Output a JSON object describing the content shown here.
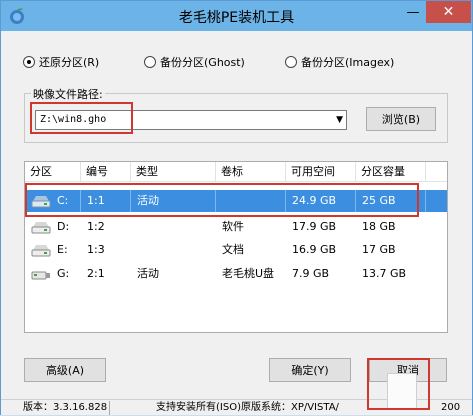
{
  "window": {
    "title": "老毛桃PE装机工具",
    "minimize_glyph": "—",
    "close_glyph": "✕"
  },
  "modes": [
    {
      "label": "还原分区(R)",
      "checked": true
    },
    {
      "label": "备份分区(Ghost)",
      "checked": false
    },
    {
      "label": "备份分区(Imagex)",
      "checked": false
    }
  ],
  "image_path": {
    "label": "映像文件路径:",
    "value": "Z:\\win8.gho",
    "browse_label": "浏览(B)"
  },
  "partition_table": {
    "columns": [
      "分区",
      "编号",
      "类型",
      "卷标",
      "可用空间",
      "分区容量"
    ],
    "rows": [
      {
        "drive": "C:",
        "number": "1:1",
        "type": "活动",
        "label": "",
        "free": "24.9 GB",
        "capacity": "25 GB",
        "selected": true
      },
      {
        "drive": "D:",
        "number": "1:2",
        "type": "",
        "label": "软件",
        "free": "17.9 GB",
        "capacity": "18 GB",
        "selected": false
      },
      {
        "drive": "E:",
        "number": "1:3",
        "type": "",
        "label": "文档",
        "free": "16.9 GB",
        "capacity": "17 GB",
        "selected": false
      },
      {
        "drive": "G:",
        "number": "2:1",
        "type": "活动",
        "label": "老毛桃U盘",
        "free": "7.9 GB",
        "capacity": "13.7 GB",
        "selected": false
      }
    ]
  },
  "buttons": {
    "advanced": "高级(A)",
    "ok": "确定(Y)",
    "cancel": "取消"
  },
  "statusbar": {
    "version": "版本：3.3.16.828",
    "systems": "支持安装所有(ISO)原版系统：XP/VISTA/",
    "right": "200"
  },
  "colors": {
    "title_bar": "#6cb4e8",
    "selection": "#3c8fe0",
    "highlight_box": "#d0372f",
    "close_button": "#c7504a"
  }
}
